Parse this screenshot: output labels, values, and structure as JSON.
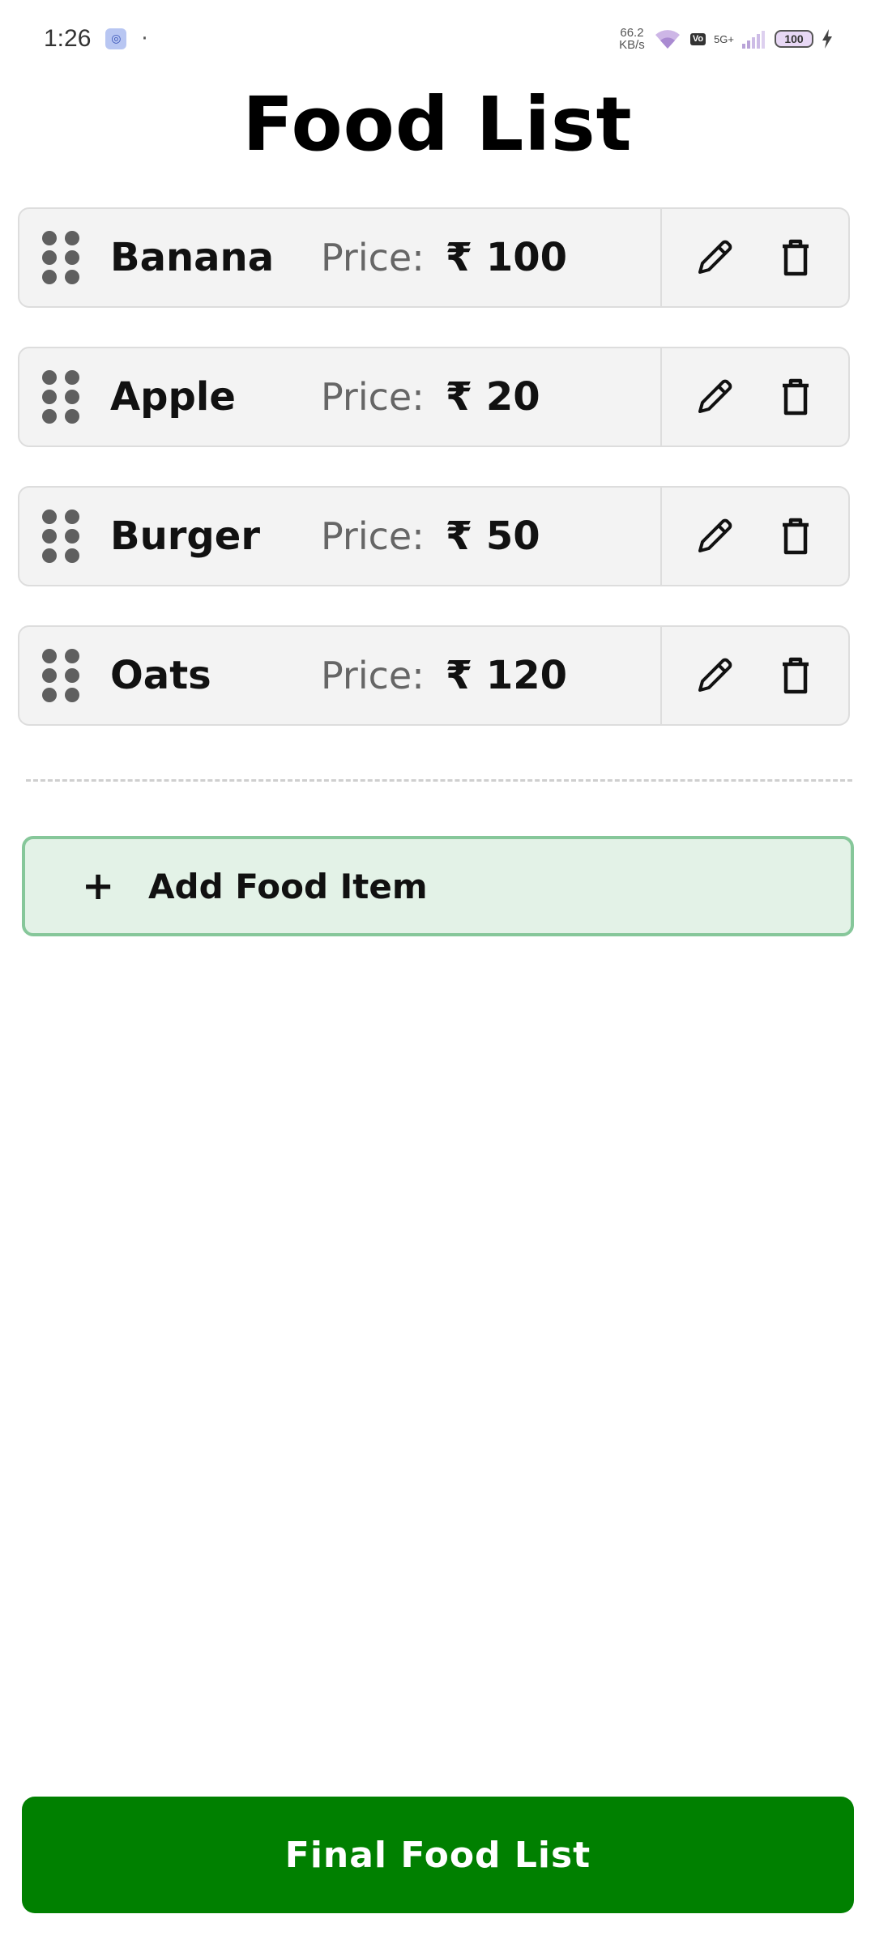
{
  "status_bar": {
    "time": "1:26",
    "network_speed_value": "66.2",
    "network_speed_unit": "KB/s",
    "volte_badge": "Vo\nNR",
    "network_type": "5G+",
    "battery_level": "100"
  },
  "page": {
    "title": "Food List"
  },
  "price_label": "Price:",
  "food_items": [
    {
      "name": "Banana",
      "price": "₹ 100"
    },
    {
      "name": "Apple",
      "price": "₹ 20"
    },
    {
      "name": "Burger",
      "price": "₹ 50"
    },
    {
      "name": "Oats",
      "price": "₹ 120"
    }
  ],
  "add_button": {
    "icon": "+",
    "label": "Add Food Item"
  },
  "final_button": {
    "label": "Final Food List"
  },
  "colors": {
    "primary_green": "#008000",
    "add_bg": "#e3f2e7",
    "add_border": "#86c79a",
    "row_bg": "#f3f3f3"
  }
}
